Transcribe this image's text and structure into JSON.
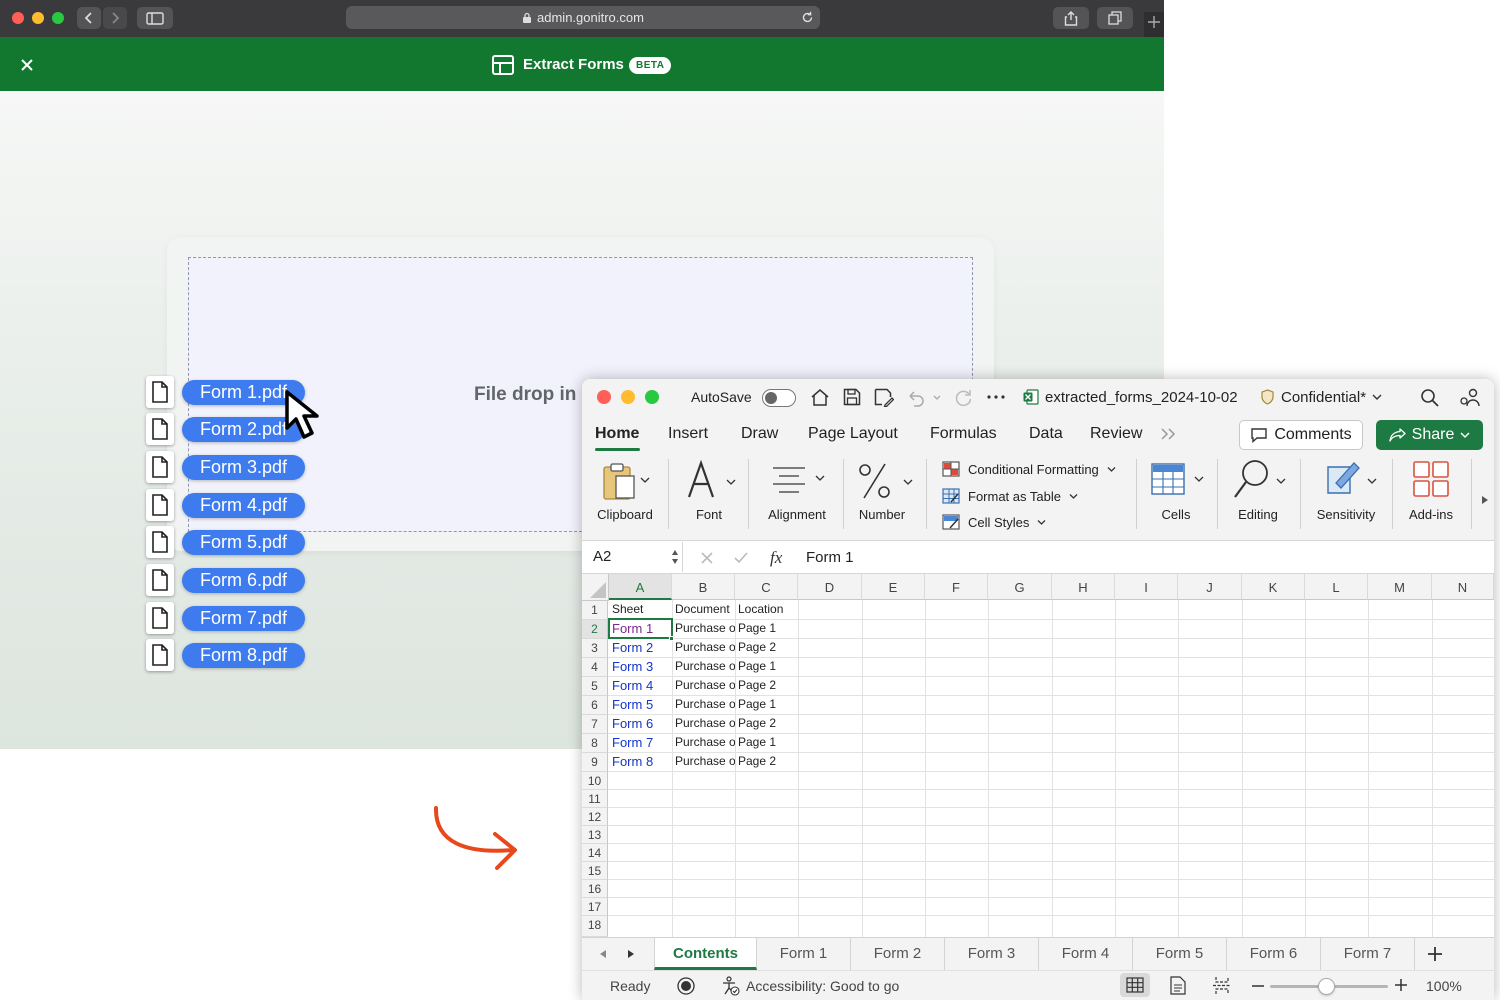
{
  "browser": {
    "url": "admin.gonitro.com",
    "app_title": "Extract Forms",
    "beta_badge": "BETA",
    "drop_label": "File drop in",
    "files": [
      "Form 1.pdf",
      "Form 2.pdf",
      "Form 3.pdf",
      "Form 4.pdf",
      "Form 5.pdf",
      "Form 6.pdf",
      "Form 7.pdf",
      "Form 8.pdf"
    ]
  },
  "excel": {
    "autosave_label": "AutoSave",
    "filename": "extracted_forms_2024-10-02",
    "sensitivity_label": "Confidential*",
    "tabs": [
      "Home",
      "Insert",
      "Draw",
      "Page Layout",
      "Formulas",
      "Data",
      "Review"
    ],
    "comments_label": "Comments",
    "share_label": "Share",
    "ribbon": {
      "clipboard": "Clipboard",
      "font": "Font",
      "alignment": "Alignment",
      "number": "Number",
      "conditional_formatting": "Conditional Formatting",
      "format_as_table": "Format as Table",
      "cell_styles": "Cell Styles",
      "cells": "Cells",
      "editing": "Editing",
      "sensitivity": "Sensitivity",
      "addins": "Add-ins"
    },
    "name_box": "A2",
    "formula_value": "Form 1",
    "columns": [
      "A",
      "B",
      "C",
      "D",
      "E",
      "F",
      "G",
      "H",
      "I",
      "J",
      "K",
      "L",
      "M",
      "N"
    ],
    "row_numbers": [
      "1",
      "2",
      "3",
      "4",
      "5",
      "6",
      "7",
      "8",
      "9",
      "10",
      "11",
      "12",
      "13",
      "14",
      "15",
      "16",
      "17",
      "18"
    ],
    "headers": [
      "Sheet",
      "Document",
      "Location"
    ],
    "rows": [
      [
        "Form 1",
        "Purchase o",
        "Page 1"
      ],
      [
        "Form 2",
        "Purchase o",
        "Page 2"
      ],
      [
        "Form 3",
        "Purchase o",
        "Page 1"
      ],
      [
        "Form 4",
        "Purchase o",
        "Page 2"
      ],
      [
        "Form 5",
        "Purchase o",
        "Page 1"
      ],
      [
        "Form 6",
        "Purchase o",
        "Page 2"
      ],
      [
        "Form 7",
        "Purchase o",
        "Page 1"
      ],
      [
        "Form 8",
        "Purchase o",
        "Page 2"
      ]
    ],
    "sheet_tabs": [
      "Contents",
      "Form 1",
      "Form 2",
      "Form 3",
      "Form 4",
      "Form 5",
      "Form 6",
      "Form 7"
    ],
    "active_sheet": "Contents",
    "status_ready": "Ready",
    "accessibility": "Accessibility: Good to go",
    "zoom": "100%"
  },
  "colors": {
    "brand_green": "#13782f",
    "chip_blue": "#3d7bef",
    "excel_green": "#1d7a42",
    "link_blue": "#1535c9",
    "arrow_orange": "#e8481c"
  }
}
